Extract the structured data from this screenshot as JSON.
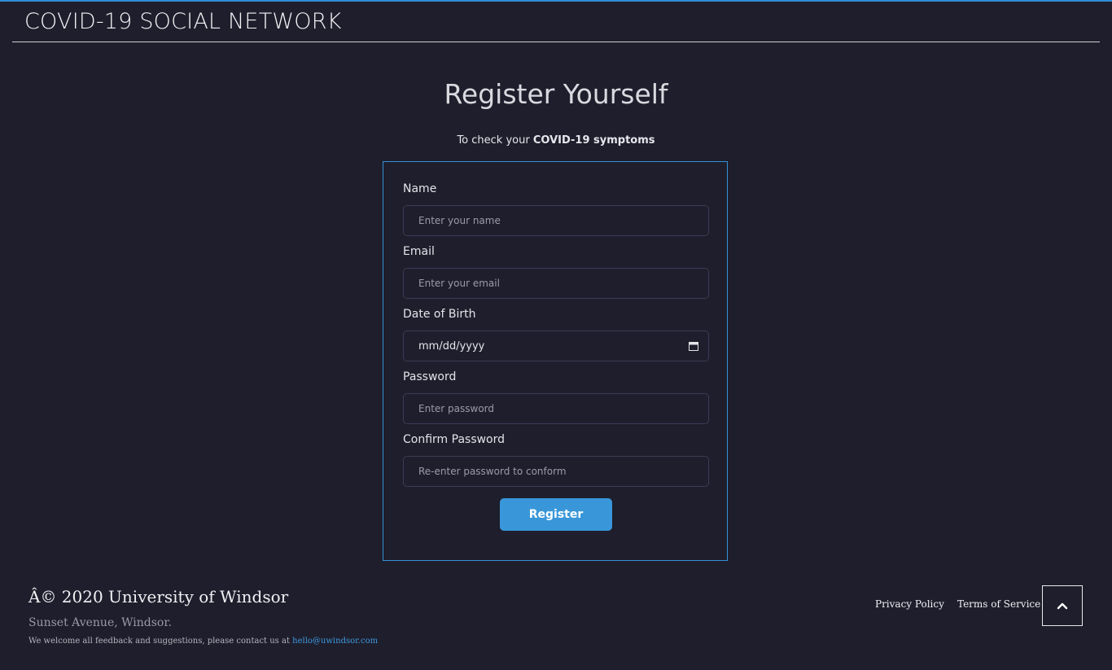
{
  "header": {
    "brand": "COVID-19 SOCIAL NETWORK"
  },
  "register": {
    "title": "Register Yourself",
    "subtitle_prefix": "To check your",
    "subtitle_bold": "COVID-19 symptoms",
    "fields": [
      {
        "label": "Name",
        "placeholder": "Enter your name"
      },
      {
        "label": "Email",
        "placeholder": "Enter your email"
      },
      {
        "label": "Date of Birth",
        "value": "mm/dd/yyyy",
        "icon": "calendar-icon"
      },
      {
        "label": "Password",
        "placeholder": "Enter password"
      },
      {
        "label": "Confirm Password",
        "placeholder": "Re-enter password to conform"
      }
    ],
    "submit_label": "Register"
  },
  "footer": {
    "copyright": "Â© 2020 University of Windsor",
    "address": "Sunset Avenue, Windsor.",
    "note_prefix": "We welcome all feedback and suggestions, please contact us at",
    "email": "hello@uwindsor.com",
    "links": [
      "Privacy Policy",
      "Terms of Service"
    ],
    "back_to_top_icon": "chevron-up-icon"
  },
  "colors": {
    "background": "#1f1e2c",
    "accent": "#3997d9",
    "card_border": "#3391d8",
    "input_border": "#3c3b56"
  }
}
